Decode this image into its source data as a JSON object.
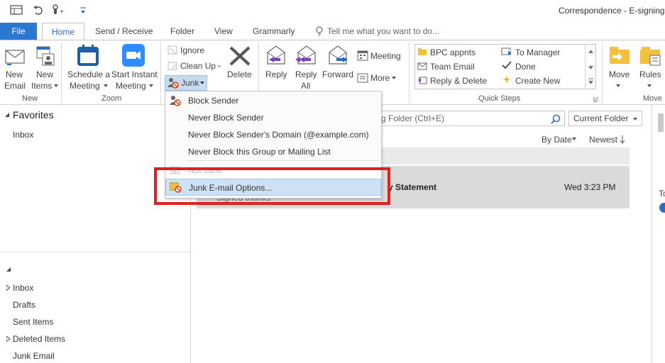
{
  "window": {
    "title": "Correspondence - E-signing"
  },
  "tabs": [
    "File",
    "Home",
    "Send / Receive",
    "Folder",
    "View",
    "Grammarly"
  ],
  "tell_me": "Tell me what you want to do...",
  "ribbon": {
    "new_email": [
      "New",
      "Email"
    ],
    "new_items": [
      "New",
      "Items"
    ],
    "schedule_meeting": [
      "Schedule a",
      "Meeting"
    ],
    "start_instant_meeting": [
      "Start Instant",
      "Meeting"
    ],
    "zoom_group": "Zoom",
    "new_group": "New",
    "ignore": "Ignore",
    "clean_up": "Clean Up",
    "junk": "Junk",
    "delete": "Delete",
    "reply": "Reply",
    "reply_all": [
      "Reply",
      "All"
    ],
    "forward": "Forward",
    "meeting": "Meeting",
    "more": "More",
    "quick_steps": {
      "left": [
        "BPC appnts",
        "Team Email",
        "Reply & Delete"
      ],
      "right": [
        "To Manager",
        "Done",
        "Create New"
      ],
      "label": "Quick Steps"
    },
    "move": "Move",
    "rules": "Rules",
    "move_group": "Move"
  },
  "junk_menu": {
    "items": [
      "Block Sender",
      "Never Block Sender",
      "Never Block Sender's Domain (@example.com)",
      "Never Block this Group or Mailing List",
      "Not Junk",
      "Junk E-mail Options..."
    ]
  },
  "nav": {
    "favorites": "Favorites",
    "favorites_inbox": "Inbox",
    "folders": [
      "Inbox",
      "Drafts",
      "Sent Items",
      "Deleted Items",
      "Junk Email"
    ]
  },
  "message_list": {
    "search_placeholder": "Search Current Mailbox Search Folder (Ctrl+E)",
    "search_visible": "g Folder (Ctrl+E)",
    "scope": "Current Folder",
    "sort_by": "By Date",
    "order": "Newest",
    "selected_subject_fragment": "y Statement",
    "selected_date": "Wed 3:23 PM",
    "selected_preview": "Signed thanks"
  },
  "right_pane": {
    "fragment": "To"
  },
  "colors": {
    "file_tab": "#2b78d1",
    "accent": "#2b6cc4",
    "highlight_box": "#e02020",
    "menu_hover": "#cfe1f4"
  }
}
